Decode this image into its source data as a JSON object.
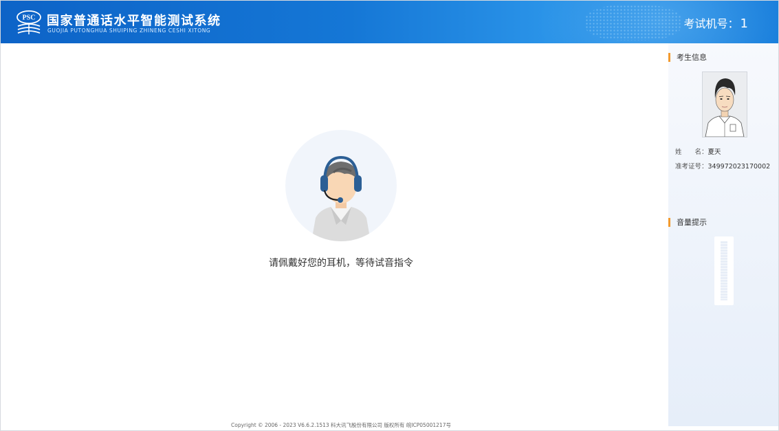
{
  "header": {
    "logo_text": "PSC",
    "title_cn": "国家普通话水平智能测试系统",
    "title_en": "GUOJIA PUTONGHUA SHUIPING ZHINENG CESHI XITONG",
    "machine_label": "考试机号：",
    "machine_number": "1"
  },
  "main": {
    "instruction": "请佩戴好您的耳机，等待试音指令",
    "copyright": "Copyright © 2006 - 2023 V6.6.2.1513 科大讯飞股份有限公司 版权所有 皖ICP05001217号"
  },
  "sidebar": {
    "candidate_title": "考生信息",
    "name_label": "姓　　名：",
    "name_value": "夏天",
    "id_label": "准考证号：",
    "id_value": "349972023170002",
    "volume_title": "音量提示",
    "volume_level": 0
  },
  "colors": {
    "header_blue": "#1577d6",
    "accent_orange": "#f29a2e",
    "headset_blue": "#2c5f95"
  }
}
